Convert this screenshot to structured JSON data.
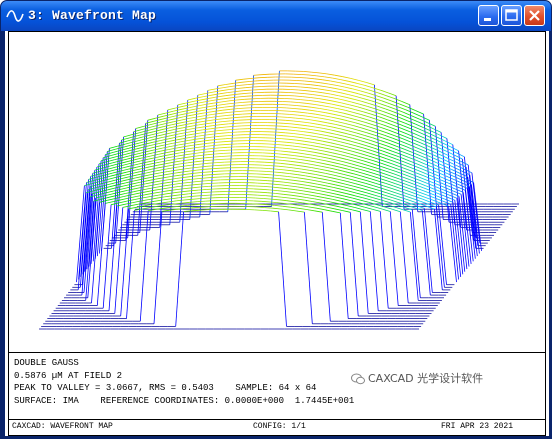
{
  "window": {
    "title": "3: Wavefront Map",
    "icon": "wave-icon",
    "controls": [
      "minimize-icon",
      "maximize-icon",
      "close-icon"
    ]
  },
  "colors": {
    "titlebar": "#0552d8",
    "close_button": "#e0502c",
    "plot_low": "#0000ff",
    "plot_high": "#ff0000"
  },
  "info": {
    "line1": "DOUBLE GAUSS",
    "line2": "0.5876 µM AT FIELD 2",
    "line3": "PEAK TO VALLEY = 3.0667, RMS = 0.5403    SAMPLE: 64 x 64",
    "line4": "SURFACE: IMA    REFERENCE COORDINATES: 0.0000E+000  1.7445E+001"
  },
  "footer": {
    "left": "CAXCAD: WAVEFRONT MAP",
    "center": "CONFIG: 1/1",
    "right": "FRI APR 23 2021"
  },
  "watermark": {
    "text": "CAXCAD 光学设计软件"
  }
}
